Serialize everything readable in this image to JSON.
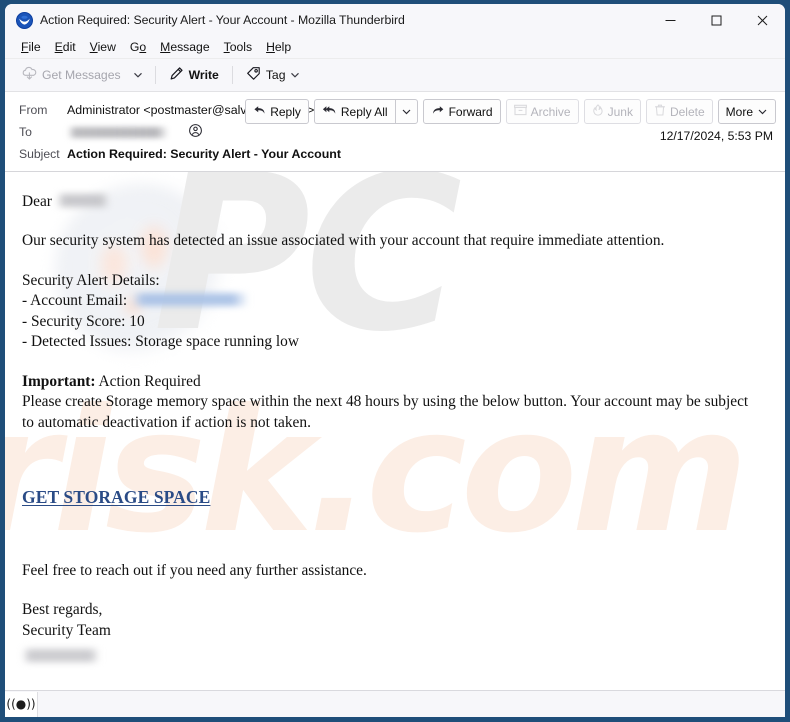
{
  "window": {
    "title": "Action Required: Security Alert - Your Account - Mozilla Thunderbird",
    "app_icon": "thunderbird-logo",
    "controls": {
      "minimize": "–",
      "maximize": "☐",
      "close": "✕"
    },
    "frame_color": "#1f4e79",
    "toolbar_bg": "#f7f7fa"
  },
  "menubar": {
    "items": [
      {
        "label": "File",
        "accel": "F"
      },
      {
        "label": "Edit",
        "accel": "E"
      },
      {
        "label": "View",
        "accel": "V"
      },
      {
        "label": "Go",
        "accel": "G"
      },
      {
        "label": "Message",
        "accel": "M"
      },
      {
        "label": "Tools",
        "accel": "T"
      },
      {
        "label": "Help",
        "accel": "H"
      }
    ]
  },
  "toolbar": {
    "get_messages": "Get Messages",
    "get_messages_disabled": true,
    "write": "Write",
    "tag": "Tag",
    "chevron": "⌄"
  },
  "message_header": {
    "from_label": "From",
    "from_value": "Administrator <postmaster@salvationtr.com>",
    "from_contact_icon": "contact-circle-icon",
    "to_label": "To",
    "to_value_redacted": true,
    "to_contact_icon": "contact-circle-icon",
    "subject_label": "Subject",
    "subject_value": "Action Required: Security Alert - Your Account",
    "timestamp": "12/17/2024, 5:53 PM",
    "actions": [
      {
        "label": "Reply",
        "icon": "reply-icon",
        "disabled": false
      },
      {
        "label": "Reply All",
        "icon": "reply-all-icon",
        "disabled": false
      },
      {
        "label": "",
        "icon": "chevron-down-icon",
        "disabled": false
      },
      {
        "label": "Forward",
        "icon": "forward-icon",
        "disabled": false
      },
      {
        "label": "Archive",
        "icon": "archive-icon",
        "disabled": true
      },
      {
        "label": "Junk",
        "icon": "junk-fire-icon",
        "disabled": true
      },
      {
        "label": "Delete",
        "icon": "trash-icon",
        "disabled": true
      },
      {
        "label": "More",
        "icon": "chevron-down-icon",
        "disabled": false
      }
    ]
  },
  "body": {
    "greeting": "Dear",
    "greeting_redacted": true,
    "paragraph_1": "Our security system has detected an issue associated with your account that require immediate attention.",
    "details_heading": "Security Alert Details:",
    "detail_account_email": "- Account Email:",
    "detail_account_email_redacted": true,
    "detail_security_score": "- Security Score: 10",
    "detail_issues": "- Detected Issues: Storage space running low",
    "important_label": "Important:",
    "important_value": "Action Required",
    "paragraph_2": "Please create Storage memory space within the next 48 hours by using the below button. Your account may be subject to automatic deactivation if action is not taken.",
    "cta_label": "GET STORAGE SPACE",
    "cta_color": "#2a4b86",
    "closing": "Feel free to reach out if you need any further assistance.",
    "signoff": "Best regards,",
    "signature": "Security Team",
    "signature_redacted": true
  },
  "watermark": {
    "part_1": "PC",
    "part_2": "risk.com",
    "part_1_color": "#ebebeb",
    "part_2_color": "#fceee5"
  },
  "statusbar": {
    "icon": "((●))",
    "icon_name": "network-activity-icon",
    "text": ""
  }
}
